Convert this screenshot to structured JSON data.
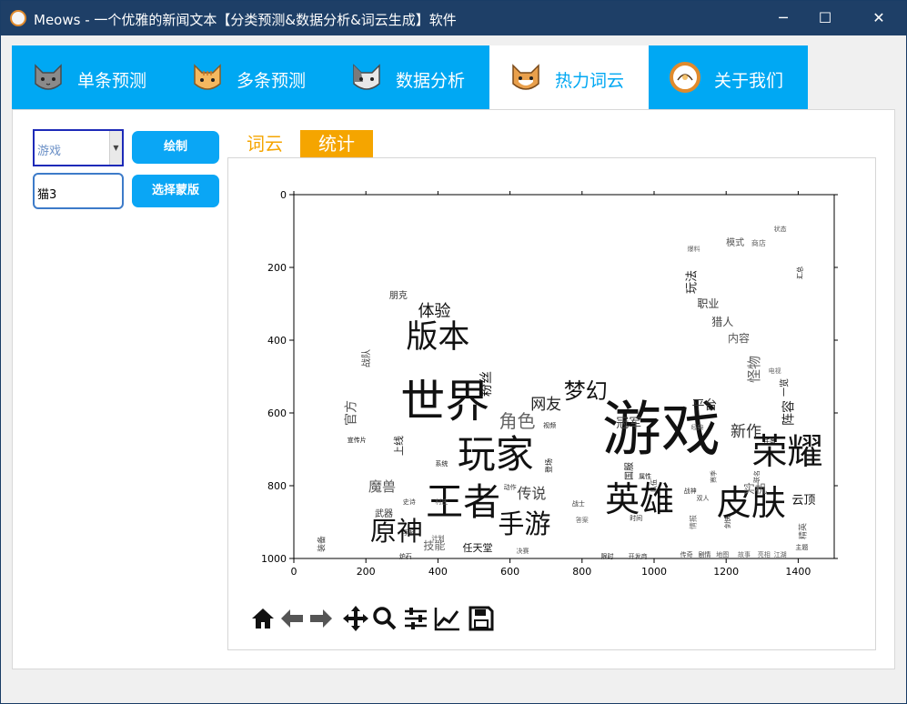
{
  "window": {
    "title": "Meows - 一个优雅的新闻文本【分类预测&数据分析&词云生成】软件",
    "minimize": "─",
    "maximize": "☐",
    "close": "✕"
  },
  "tabs": [
    {
      "label": "单条预测",
      "active": false
    },
    {
      "label": "多条预测",
      "active": false
    },
    {
      "label": "数据分析",
      "active": false
    },
    {
      "label": "热力词云",
      "active": true
    },
    {
      "label": "关于我们",
      "active": false
    }
  ],
  "controls": {
    "category_select": "游戏",
    "mask_input": "猫3",
    "draw_button": "绘制",
    "mask_button": "选择蒙版"
  },
  "subtabs": {
    "wordcloud": "词云",
    "stats": "统计"
  },
  "colors": {
    "accent": "#00a8f3",
    "stats_tab_bg": "#f5a500",
    "wordcloud_tab_text": "#f5a500",
    "titlebar": "#1e3f67"
  },
  "axes": {
    "x_ticks": [
      "0",
      "200",
      "400",
      "600",
      "800",
      "1000",
      "1200",
      "1400"
    ],
    "y_ticks": [
      "0",
      "200",
      "400",
      "600",
      "800",
      "1000"
    ]
  },
  "wordcloud": [
    {
      "t": "游戏",
      "s": 0.95
    },
    {
      "t": "世界",
      "s": 0.72
    },
    {
      "t": "玩家",
      "s": 0.62
    },
    {
      "t": "王者",
      "s": 0.6
    },
    {
      "t": "荣耀",
      "s": 0.58
    },
    {
      "t": "英雄",
      "s": 0.56
    },
    {
      "t": "皮肤",
      "s": 0.56
    },
    {
      "t": "版本",
      "s": 0.52
    },
    {
      "t": "原神",
      "s": 0.42
    },
    {
      "t": "手游",
      "s": 0.42
    },
    {
      "t": "梦幻",
      "s": 0.36
    },
    {
      "t": "角色",
      "s": 0.3
    },
    {
      "t": "体验",
      "s": 0.27
    },
    {
      "t": "网友",
      "s": 0.25
    },
    {
      "t": "新作",
      "s": 0.25
    },
    {
      "t": "传说",
      "s": 0.24
    },
    {
      "t": "魔兽",
      "s": 0.22
    },
    {
      "t": "怪物",
      "s": 0.22
    },
    {
      "t": "粉丝",
      "s": 0.2
    },
    {
      "t": "阵容",
      "s": 0.2
    },
    {
      "t": "平台",
      "s": 0.2
    },
    {
      "t": "冠军",
      "s": 0.2
    },
    {
      "t": "官方",
      "s": 0.2
    },
    {
      "t": "实机",
      "s": 0.19
    },
    {
      "t": "云顶",
      "s": 0.19
    },
    {
      "t": "玩法",
      "s": 0.19
    },
    {
      "t": "职业",
      "s": 0.18
    },
    {
      "t": "猎人",
      "s": 0.18
    },
    {
      "t": "内容",
      "s": 0.18
    },
    {
      "t": "技能",
      "s": 0.17
    },
    {
      "t": "任天堂",
      "s": 0.16
    },
    {
      "t": "上线",
      "s": 0.16
    },
    {
      "t": "朋克",
      "s": 0.14
    },
    {
      "t": "战队",
      "s": 0.14
    },
    {
      "t": "模式",
      "s": 0.14
    },
    {
      "t": "商店",
      "s": 0.12
    },
    {
      "t": "一览",
      "s": 0.14
    },
    {
      "t": "国服",
      "s": 0.14
    },
    {
      "t": "武器",
      "s": 0.14
    },
    {
      "t": "装备",
      "s": 0.13
    },
    {
      "t": "精英",
      "s": 0.13
    },
    {
      "t": "情报",
      "s": 0.12
    },
    {
      "t": "登场",
      "s": 0.12
    },
    {
      "t": "炉石",
      "s": 0.11
    },
    {
      "t": "手柄",
      "s": 0.1
    },
    {
      "t": "计划",
      "s": 0.1
    },
    {
      "t": "决赛",
      "s": 0.1
    },
    {
      "t": "爆料",
      "s": 0.1
    },
    {
      "t": "汇总",
      "s": 0.1
    },
    {
      "t": "视频",
      "s": 0.09
    },
    {
      "t": "战士",
      "s": 0.09
    },
    {
      "t": "开发商",
      "s": 0.09
    },
    {
      "t": "地图",
      "s": 0.09
    },
    {
      "t": "故事",
      "s": 0.09
    },
    {
      "t": "宣传片",
      "s": 0.08
    },
    {
      "t": "系统",
      "s": 0.08
    },
    {
      "t": "动作",
      "s": 0.08
    },
    {
      "t": "史诗",
      "s": 0.08
    },
    {
      "t": "村庄",
      "s": 0.08
    },
    {
      "t": "经典",
      "s": 0.08
    },
    {
      "t": "任务",
      "s": 0.08
    },
    {
      "t": "限时",
      "s": 0.08
    },
    {
      "t": "剧情",
      "s": 0.08
    },
    {
      "t": "传奇",
      "s": 0.08
    },
    {
      "t": "状态",
      "s": 0.07
    },
    {
      "t": "电视",
      "s": 0.07
    },
    {
      "t": "属性",
      "s": 0.07
    },
    {
      "t": "队伍",
      "s": 0.07
    },
    {
      "t": "战神",
      "s": 0.07
    },
    {
      "t": "双人",
      "s": 0.07
    },
    {
      "t": "江湖",
      "s": 0.07
    },
    {
      "t": "亮相",
      "s": 0.07
    },
    {
      "t": "剑侠",
      "s": 0.07
    },
    {
      "t": "时间",
      "s": 0.07
    },
    {
      "t": "主题",
      "s": 0.06
    },
    {
      "t": "联名",
      "s": 0.06
    },
    {
      "t": "赛季",
      "s": 0.06
    },
    {
      "t": "答案",
      "s": 0.06
    }
  ]
}
